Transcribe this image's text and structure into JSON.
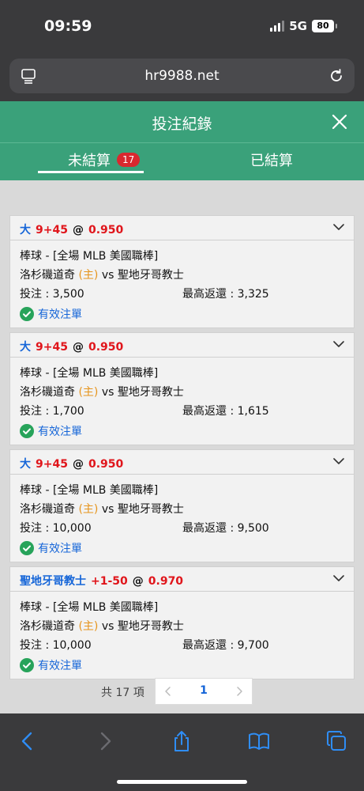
{
  "status_bar": {
    "time": "09:59",
    "network": "5G",
    "battery": "80"
  },
  "browser": {
    "url": "hr9988.net"
  },
  "header": {
    "title": "投注紀錄"
  },
  "tabs": [
    {
      "label": "未結算",
      "badge": "17",
      "active": true
    },
    {
      "label": "已結算",
      "active": false
    }
  ],
  "bets": [
    {
      "selection": "大",
      "line": "9+45",
      "at": "@",
      "odds": "0.950",
      "sport": "棒球 - [全場 MLB 美國職棒]",
      "home_team": "洛杉磯道奇",
      "home_tag": "(主)",
      "vs": "vs",
      "away_team": "聖地牙哥教士",
      "stake_label": "投注 : 3,500",
      "payout_label": "最高返還 : 3,325",
      "status": "有效注單"
    },
    {
      "selection": "大",
      "line": "9+45",
      "at": "@",
      "odds": "0.950",
      "sport": "棒球 - [全場 MLB 美國職棒]",
      "home_team": "洛杉磯道奇",
      "home_tag": "(主)",
      "vs": "vs",
      "away_team": "聖地牙哥教士",
      "stake_label": "投注 : 1,700",
      "payout_label": "最高返還 : 1,615",
      "status": "有效注單"
    },
    {
      "selection": "大",
      "line": "9+45",
      "at": "@",
      "odds": "0.950",
      "sport": "棒球 - [全場 MLB 美國職棒]",
      "home_team": "洛杉磯道奇",
      "home_tag": "(主)",
      "vs": "vs",
      "away_team": "聖地牙哥教士",
      "stake_label": "投注 : 10,000",
      "payout_label": "最高返還 : 9,500",
      "status": "有效注單"
    },
    {
      "selection": "聖地牙哥教士",
      "line": "+1-50",
      "at": "@",
      "odds": "0.970",
      "sport": "棒球 - [全場 MLB 美國職棒]",
      "home_team": "洛杉磯道奇",
      "home_tag": "(主)",
      "vs": "vs",
      "away_team": "聖地牙哥教士",
      "stake_label": "投注 : 10,000",
      "payout_label": "最高返還 : 9,700",
      "status": "有效注單"
    }
  ],
  "pager": {
    "total_label": "共 17 項",
    "current_page": "1"
  },
  "colors": {
    "header_green": "#3aa17a",
    "accent_blue": "#1565d8",
    "odds_red": "#e0151b",
    "badge_red": "#d9282f",
    "home_orange": "#e6941c"
  },
  "icons": {
    "page": "page-menu-icon",
    "reload": "reload-icon",
    "close": "close-icon",
    "chevron": "chevron-down-icon",
    "check": "check-circle-icon",
    "back": "back-icon",
    "forward": "forward-icon",
    "share": "share-icon",
    "bookmarks": "bookmarks-icon",
    "tabs": "tabs-icon"
  }
}
